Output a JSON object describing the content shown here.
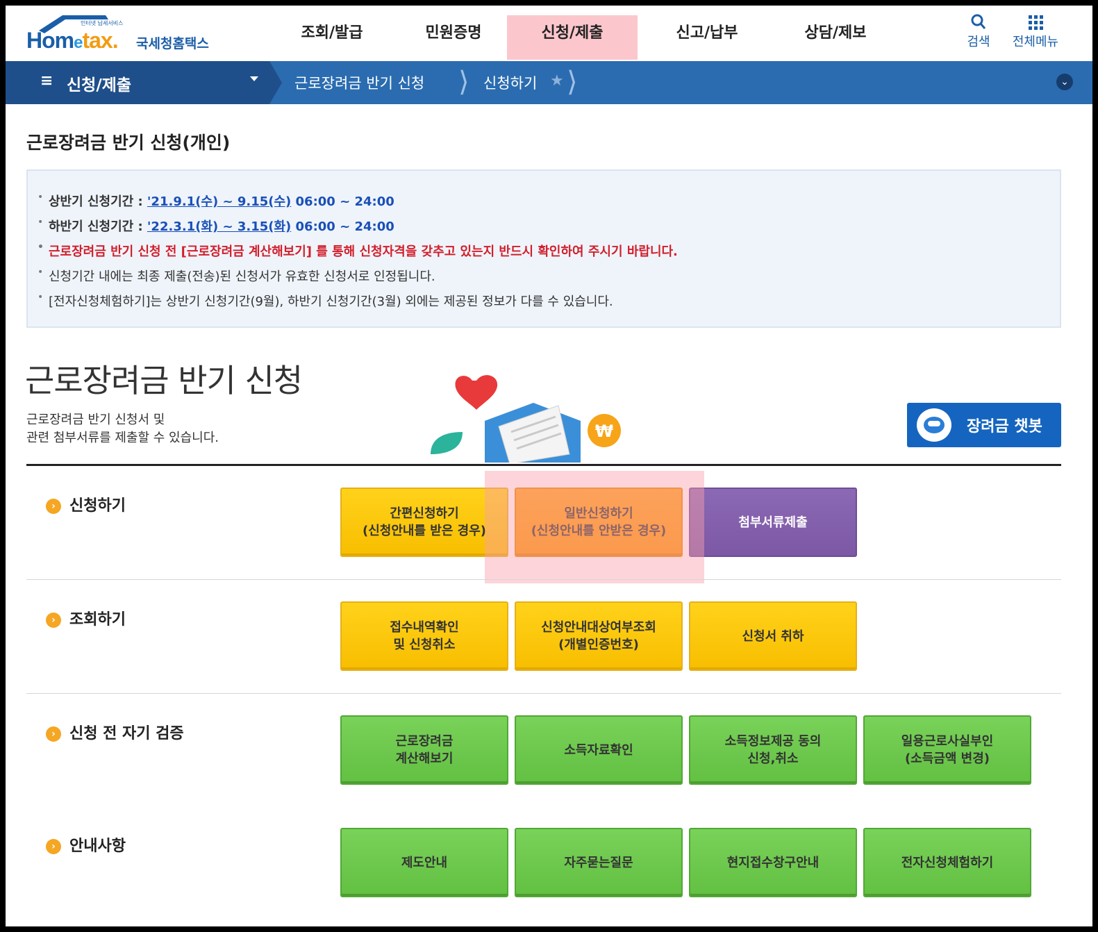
{
  "logo": {
    "small": "인터넷 납세서비스",
    "word_h": "Hom",
    "word_e": "e",
    "word_tax": "tax.",
    "kor": "국세청홈택스"
  },
  "topnav": {
    "items": [
      "조회/발급",
      "민원증명",
      "신청/제출",
      "신고/납부",
      "상담/제보"
    ],
    "active_index": 2,
    "search_label": "검색",
    "allmenu_label": "전체메뉴"
  },
  "subbar": {
    "menu_title": "신청/제출",
    "crumb1": "근로장려금 반기 신청",
    "crumb2": "신청하기"
  },
  "page": {
    "small_title": "근로장려금 반기 신청(개인)",
    "big_title": "근로장려금 반기 신청",
    "desc_line1": "근로장려금 반기 신청서 및",
    "desc_line2": "관련 첨부서류를 제출할 수 있습니다."
  },
  "info": {
    "l1_label": "상반기 신청기간 : ",
    "l1_link": "'21.9.1(수) ~ 9.15(수)",
    "l1_time": " 06:00 ~ 24:00",
    "l2_label": "하반기 신청기간 : ",
    "l2_link": "'22.3.1(화) ~ 3.15(화)",
    "l2_time": " 06:00 ~ 24:00",
    "l3": "근로장려금 반기 신청 전 [근로장려금 계산해보기] 를 통해 신청자격을 갖추고 있는지 반드시 확인하여 주시기 바랍니다.",
    "l4": "신청기간 내에는 최종 제출(전송)된 신청서가 유효한 신청서로 인정됩니다.",
    "l5": "[전자신청체험하기]는 상반기 신청기간(9월), 하반기 신청기간(3월) 외에는 제공된 정보가 다를 수 있습니다."
  },
  "chatbot": {
    "label": "장려금 챗봇"
  },
  "sections": {
    "apply": {
      "label": "신청하기",
      "buttons": [
        {
          "l1": "간편신청하기",
          "l2": "(신청안내를 받은 경우)"
        },
        {
          "l1": "일반신청하기",
          "l2": "(신청안내를 안받은 경우)"
        },
        {
          "l1": "첨부서류제출",
          "l2": ""
        }
      ]
    },
    "inquiry": {
      "label": "조회하기",
      "buttons": [
        {
          "l1": "접수내역확인",
          "l2": "및 신청취소"
        },
        {
          "l1": "신청안내대상여부조회",
          "l2": "(개별인증번호)"
        },
        {
          "l1": "신청서 취하",
          "l2": ""
        }
      ]
    },
    "verify": {
      "label": "신청 전 자기 검증",
      "buttons": [
        {
          "l1": "근로장려금",
          "l2": "계산해보기"
        },
        {
          "l1": "소득자료확인",
          "l2": ""
        },
        {
          "l1": "소득정보제공 동의",
          "l2": "신청,취소"
        },
        {
          "l1": "일용근로사실부인",
          "l2": "(소득금액 변경)"
        }
      ]
    },
    "guide": {
      "label": "안내사항",
      "buttons": [
        {
          "l1": "제도안내",
          "l2": ""
        },
        {
          "l1": "자주묻는질문",
          "l2": ""
        },
        {
          "l1": "현지접수창구안내",
          "l2": ""
        },
        {
          "l1": "전자신청체험하기",
          "l2": ""
        }
      ]
    }
  },
  "colors": {
    "nav_blue": "#2b6cb0",
    "nav_dark": "#1f4f8a",
    "yellow": "#ffd21a",
    "orange": "#fb9500",
    "purple": "#7c58a5",
    "green": "#62c042",
    "highlight": "#fbc5cb"
  }
}
